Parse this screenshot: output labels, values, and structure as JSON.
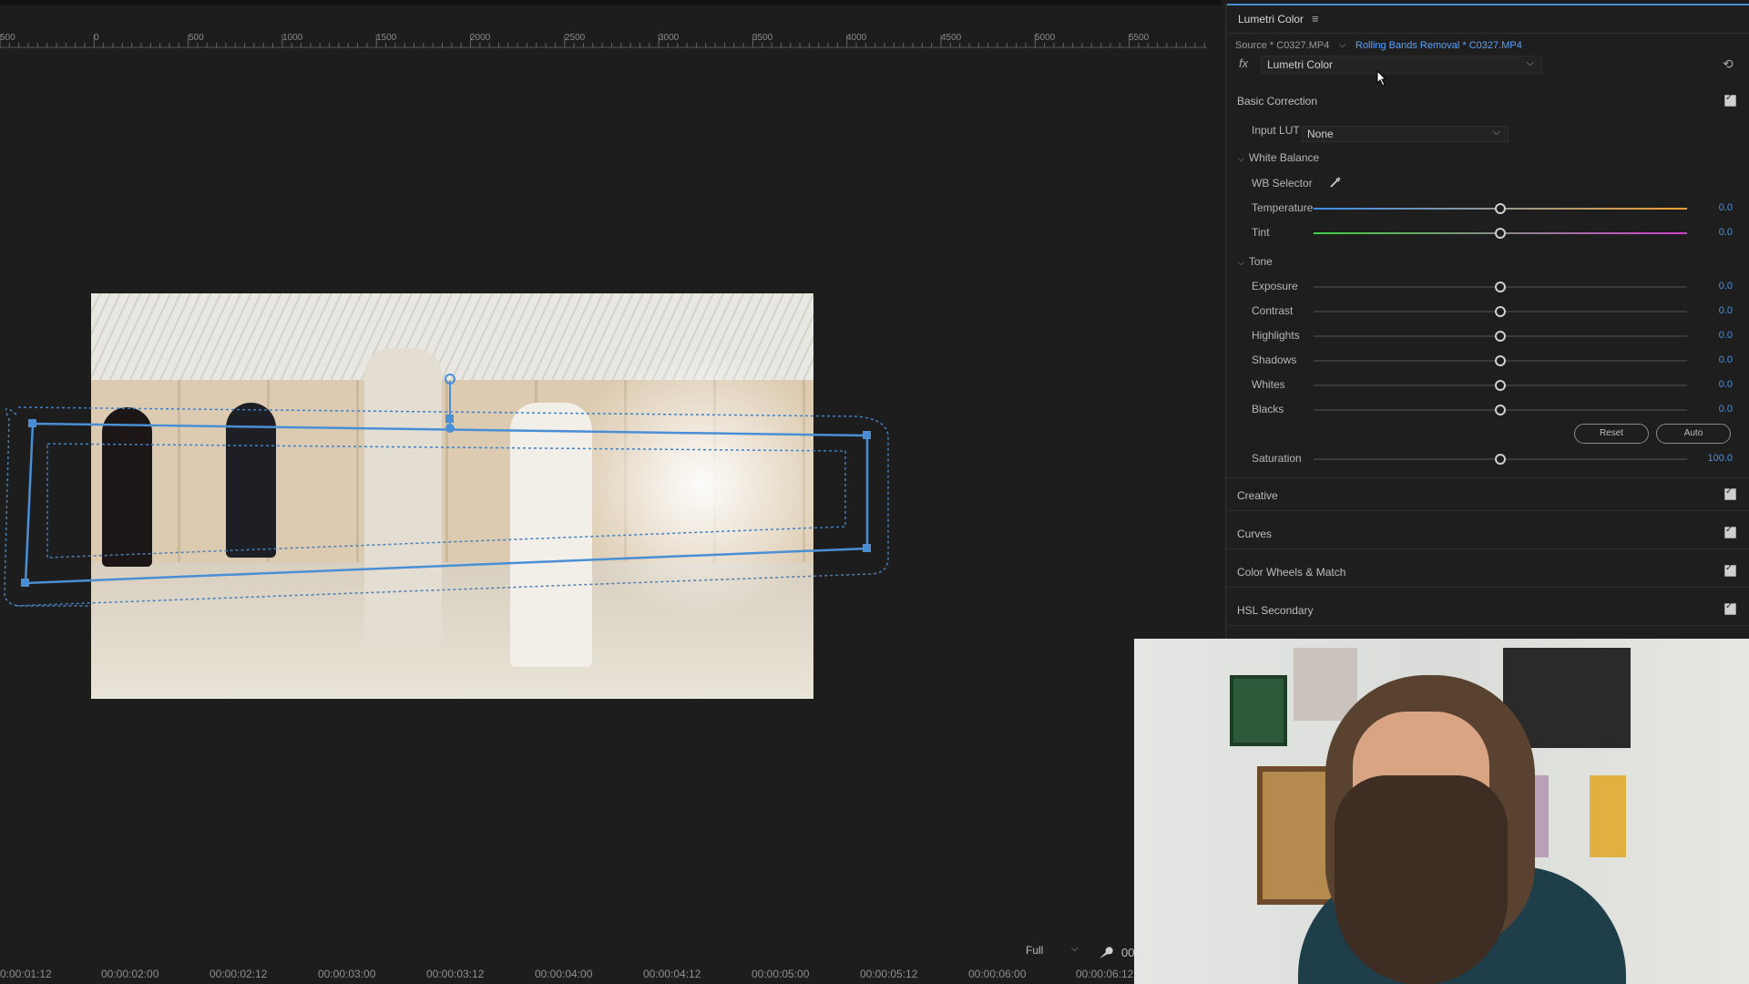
{
  "ruler": {
    "ticks": [
      "500",
      "0",
      "500",
      "1000",
      "1500",
      "2000",
      "2500",
      "3000",
      "3500",
      "4000",
      "4500",
      "5000",
      "5500"
    ]
  },
  "timeline": {
    "timecodes": [
      "0:00:01:12",
      "00:00:02:00",
      "00:00:02:12",
      "00:00:03:00",
      "00:00:03:12",
      "00:00:04:00",
      "00:00:04:12",
      "00:00:05:00",
      "00:00:05:12",
      "00:00:06:00",
      "00:00:06:12"
    ],
    "zoom": "Full",
    "current_timecode_partial": "00"
  },
  "panel": {
    "title": "Lumetri Color",
    "menu_icon": "hamburger-icon",
    "source_label": "Source * C0327.MP4",
    "clip_link": "Rolling Bands Removal * C0327.MP4",
    "fx_label": "fx",
    "effect": "Lumetri Color",
    "basic_correction": {
      "title": "Basic Correction",
      "input_lut_label": "Input LUT",
      "input_lut_value": "None",
      "white_balance": {
        "title": "White Balance",
        "wb_selector_label": "WB Selector",
        "temperature": {
          "label": "Temperature",
          "value": "0.0",
          "level": 0.5
        },
        "tint": {
          "label": "Tint",
          "value": "0.0",
          "level": 0.5
        }
      },
      "tone": {
        "title": "Tone",
        "sliders": [
          {
            "label": "Exposure",
            "value": "0.0",
            "level": 0.5
          },
          {
            "label": "Contrast",
            "value": "0.0",
            "level": 0.5
          },
          {
            "label": "Highlights",
            "value": "0.0",
            "level": 0.5
          },
          {
            "label": "Shadows",
            "value": "0.0",
            "level": 0.5
          },
          {
            "label": "Whites",
            "value": "0.0",
            "level": 0.5
          },
          {
            "label": "Blacks",
            "value": "0.0",
            "level": 0.5
          }
        ],
        "reset_label": "Reset",
        "auto_label": "Auto"
      },
      "saturation": {
        "label": "Saturation",
        "value": "100.0",
        "level": 0.5
      }
    },
    "sections": [
      "Creative",
      "Curves",
      "Color Wheels & Match",
      "HSL Secondary"
    ]
  },
  "colors": {
    "accent": "#4a90e2",
    "temperature_warm": "#f0a030",
    "tint_magenta": "#d040d0",
    "tint_green": "#40d040"
  }
}
